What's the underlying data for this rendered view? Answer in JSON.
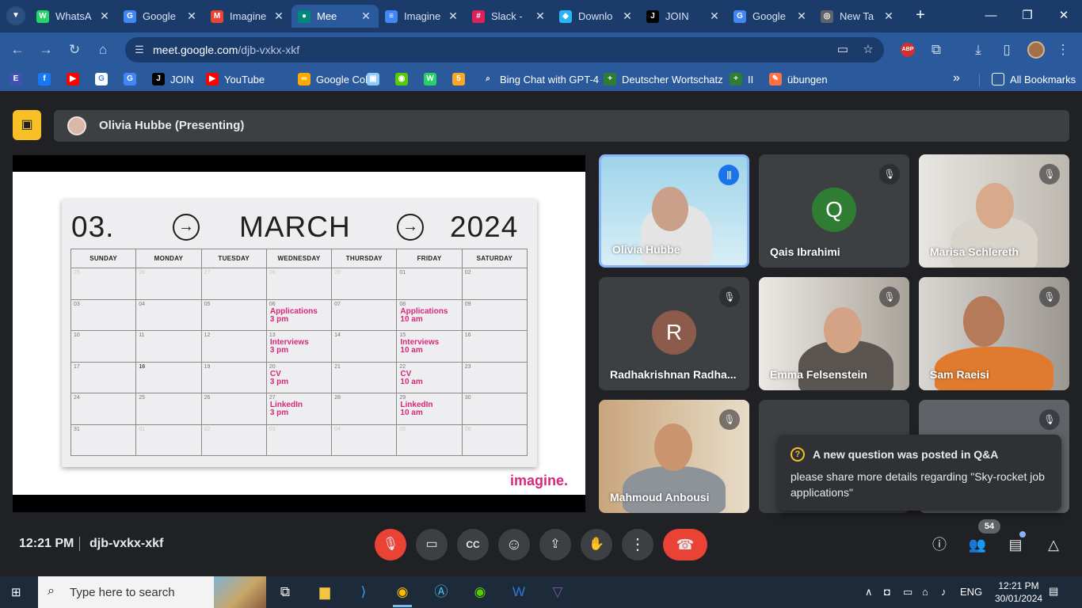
{
  "browser": {
    "tabs": [
      {
        "label": "WhatsA",
        "icon": "whatsapp-icon",
        "color": "#25d366",
        "glyph": "W"
      },
      {
        "label": "Google",
        "icon": "google-translate-icon",
        "color": "#4285f4",
        "glyph": "G"
      },
      {
        "label": "Imagine",
        "icon": "gmail-icon",
        "color": "#ea4335",
        "glyph": "M"
      },
      {
        "label": "Mee",
        "icon": "google-meet-icon",
        "color": "#00897b",
        "glyph": "●",
        "active": true
      },
      {
        "label": "Imagine",
        "icon": "google-docs-icon",
        "color": "#4285f4",
        "glyph": "≡"
      },
      {
        "label": "Slack - ",
        "icon": "slack-icon",
        "color": "#e01e5a",
        "glyph": "#"
      },
      {
        "label": "Downlo",
        "icon": "download-site-icon",
        "color": "#29b6f6",
        "glyph": "◆"
      },
      {
        "label": "JOIN",
        "icon": "join-icon",
        "color": "#000000",
        "glyph": "J"
      },
      {
        "label": "Google",
        "icon": "google-translate-icon",
        "color": "#4285f4",
        "glyph": "G"
      },
      {
        "label": "New Ta",
        "icon": "chrome-icon",
        "color": "#5f6368",
        "glyph": "◎"
      }
    ],
    "url_host": "meet.google.com",
    "url_path": "/djb-vxkx-xkf",
    "bookmarks": [
      {
        "label": "",
        "icon": "extension-bookmark-icon",
        "color": "#3f51b5",
        "glyph": "E"
      },
      {
        "label": "",
        "icon": "facebook-icon",
        "color": "#1877f2",
        "glyph": "f"
      },
      {
        "label": "",
        "icon": "youtube-icon",
        "color": "#ff0000",
        "glyph": "▶"
      },
      {
        "label": "",
        "icon": "google-icon",
        "color": "#ffffff",
        "glyph": "G"
      },
      {
        "label": "",
        "icon": "google-translate-icon",
        "color": "#4285f4",
        "glyph": "G"
      },
      {
        "label": "JOIN",
        "icon": "join-icon",
        "color": "#000000",
        "glyph": "J"
      },
      {
        "label": "YouTube",
        "icon": "youtube-icon",
        "color": "#ff0000",
        "glyph": "▶"
      },
      {
        "label": "Google Colab",
        "icon": "colab-icon",
        "color": "#f9ab00",
        "glyph": "∞"
      },
      {
        "label": "",
        "icon": "image-bookmark-icon",
        "color": "#90caf9",
        "glyph": "▣"
      },
      {
        "label": "",
        "icon": "duolingo-icon",
        "color": "#58cc02",
        "glyph": "◉"
      },
      {
        "label": "",
        "icon": "whatsapp-icon",
        "color": "#25d366",
        "glyph": "W"
      },
      {
        "label": "",
        "icon": "number-five-icon",
        "color": "#f9a825",
        "glyph": "5"
      },
      {
        "label": "Bing Chat with GPT-4",
        "icon": "bing-search-icon",
        "color": "#2b5a9c",
        "glyph": "⌕"
      },
      {
        "label": "Deutscher Wortschatz",
        "icon": "plus-doc-icon",
        "color": "#2e7d32",
        "glyph": "+"
      },
      {
        "label": "II",
        "icon": "plus-doc-icon",
        "color": "#2e7d32",
        "glyph": "+"
      },
      {
        "label": "übungen",
        "icon": "pencil-icon",
        "color": "#ff7043",
        "glyph": "✎"
      }
    ],
    "all_bookmarks": "All Bookmarks"
  },
  "meet": {
    "presenter": "Olivia Hubbe (Presenting)",
    "time": "12:21 PM",
    "code": "djb-vxkx-xkf",
    "participant_count": "54",
    "participants": [
      {
        "name": "Olivia Hubbe",
        "speaking": true
      },
      {
        "name": "Qais Ibrahimi",
        "initial": "Q",
        "color": "#2e7d32"
      },
      {
        "name": "Marisa Schlereth"
      },
      {
        "name": "Radhakrishnan Radha...",
        "initial": "R",
        "color": "#8d5b4c"
      },
      {
        "name": "Emma Felsenstein"
      },
      {
        "name": "Sam Raeisi"
      },
      {
        "name": "Mahmoud Anbousi"
      }
    ],
    "toast": {
      "title": "A new question was posted in Q&A",
      "body": "please share more details regarding \"Sky-rocket job applications\""
    }
  },
  "slide": {
    "day": "03.",
    "month": "MARCH",
    "year": "2024",
    "weekdays": [
      "SUNDAY",
      "MONDAY",
      "TUESDAY",
      "WEDNESDAY",
      "THURSDAY",
      "FRIDAY",
      "SATURDAY"
    ],
    "weeks": [
      [
        {
          "d": "25",
          "f": true
        },
        {
          "d": "26",
          "f": true
        },
        {
          "d": "27",
          "f": true
        },
        {
          "d": "28",
          "f": true
        },
        {
          "d": "29",
          "f": true
        },
        {
          "d": "01"
        },
        {
          "d": "02"
        }
      ],
      [
        {
          "d": "03"
        },
        {
          "d": "04"
        },
        {
          "d": "05"
        },
        {
          "d": "06",
          "e1": "Applications",
          "e2": "3 pm"
        },
        {
          "d": "07"
        },
        {
          "d": "08",
          "e1": "Applications",
          "e2": "10 am"
        },
        {
          "d": "09"
        }
      ],
      [
        {
          "d": "10"
        },
        {
          "d": "11"
        },
        {
          "d": "12"
        },
        {
          "d": "13",
          "e1": "Interviews",
          "e2": "3 pm"
        },
        {
          "d": "14"
        },
        {
          "d": "15",
          "e1": "Interviews",
          "e2": "10 am"
        },
        {
          "d": "16"
        }
      ],
      [
        {
          "d": "17"
        },
        {
          "d": "18",
          "dark": true
        },
        {
          "d": "19"
        },
        {
          "d": "20",
          "e1": "CV",
          "e2": "3 pm"
        },
        {
          "d": "21"
        },
        {
          "d": "22",
          "e1": "CV",
          "e2": "10 am"
        },
        {
          "d": "23"
        }
      ],
      [
        {
          "d": "24"
        },
        {
          "d": "25"
        },
        {
          "d": "26"
        },
        {
          "d": "27",
          "e1": "LinkedIn",
          "e2": "3 pm"
        },
        {
          "d": "28"
        },
        {
          "d": "29",
          "e1": "LinkedIn",
          "e2": "10 am"
        },
        {
          "d": "30"
        }
      ],
      [
        {
          "d": "31"
        },
        {
          "d": "01",
          "f": true
        },
        {
          "d": "02",
          "f": true
        },
        {
          "d": "03",
          "f": true
        },
        {
          "d": "04",
          "f": true
        },
        {
          "d": "05",
          "f": true
        },
        {
          "d": "06",
          "f": true
        }
      ]
    ],
    "brand": "imagine."
  },
  "taskbar": {
    "search_placeholder": "Type here to search",
    "language": "ENG",
    "time": "12:21 PM",
    "date": "30/01/2024"
  }
}
